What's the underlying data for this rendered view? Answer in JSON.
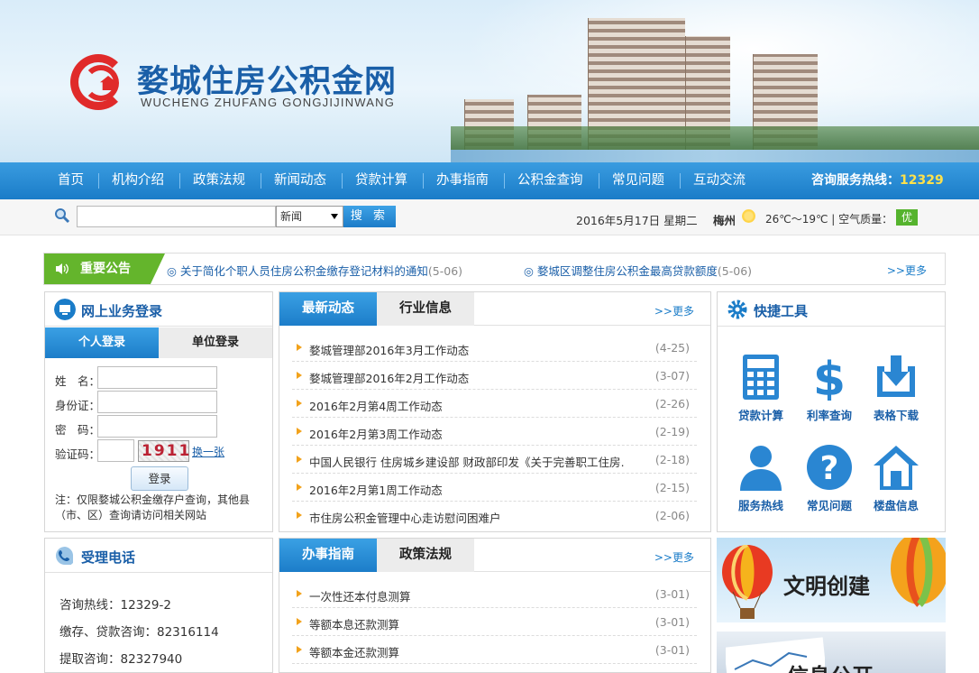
{
  "site": {
    "title": "婺城住房公积金网",
    "subtitle": "WUCHENG ZHUFANG GONGJIJINWANG"
  },
  "nav": {
    "items": [
      "首页",
      "机构介绍",
      "政策法规",
      "新闻动态",
      "贷款计算",
      "办事指南",
      "公积金查询",
      "常见问题",
      "互动交流"
    ],
    "hotline_label": "咨询服务热线：",
    "hotline_number": "12329"
  },
  "toolbar": {
    "search_value": "",
    "search_scope": "新闻",
    "search_button": "搜 索",
    "date": "2016年5月17日 星期二",
    "city": "梅州",
    "weather": "26℃～19℃ | 空气质量：",
    "air_quality": "优"
  },
  "notice": {
    "label": "重要公告",
    "items": [
      {
        "title": "关于简化个职人员住房公积金缴存登记材料的通知",
        "date": "(5-06)"
      },
      {
        "title": "婺城区调整住房公积金最高贷款额度",
        "date": "(5-06)"
      }
    ],
    "more": ">>更多"
  },
  "login": {
    "title": "网上业务登录",
    "tab_personal": "个人登录",
    "tab_unit": "单位登录",
    "name_label": "姓　名：",
    "id_label": "身份证：",
    "password_label": "密　码：",
    "captcha_label": "验证码：",
    "captcha_code": "1911",
    "captcha_refresh": "换一张",
    "submit": "登录",
    "note": "注：仅限婺城公积金缴存户查询，其他县（市、区）查询请访问相关网站"
  },
  "news": {
    "tab_active": "最新动态",
    "tab_other": "行业信息",
    "more": ">>更多",
    "items": [
      {
        "title": "婺城管理部2016年3月工作动态",
        "date": "(4-25)"
      },
      {
        "title": "婺城管理部2016年2月工作动态",
        "date": "(3-07)"
      },
      {
        "title": "2016年2月第4周工作动态",
        "date": "(2-26)"
      },
      {
        "title": "2016年2月第3周工作动态",
        "date": "(2-19)"
      },
      {
        "title": "中国人民银行 住房城乡建设部 财政部印发《关于完善职工住房…",
        "date": "(2-18)"
      },
      {
        "title": "2016年2月第1周工作动态",
        "date": "(2-15)"
      },
      {
        "title": "市住房公积金管理中心走访慰问困难户",
        "date": "(2-06)"
      }
    ]
  },
  "tools": {
    "title": "快捷工具",
    "items": [
      {
        "label": "贷款计算",
        "icon": "calculator-icon"
      },
      {
        "label": "利率查询",
        "icon": "dollar-icon"
      },
      {
        "label": "表格下载",
        "icon": "download-icon"
      },
      {
        "label": "服务热线",
        "icon": "user-icon"
      },
      {
        "label": "常见问题",
        "icon": "question-icon"
      },
      {
        "label": "楼盘信息",
        "icon": "house-icon"
      }
    ]
  },
  "phone": {
    "title": "受理电话",
    "lines": [
      "咨询热线：12329-2",
      "缴存、贷款咨询：82316114",
      "提取咨询：82327940"
    ]
  },
  "guide": {
    "tab_active": "办事指南",
    "tab_other": "政策法规",
    "more": ">>更多",
    "items": [
      {
        "title": "一次性还本付息测算",
        "date": "(3-01)"
      },
      {
        "title": "等额本息还款测算",
        "date": "(3-01)"
      },
      {
        "title": "等额本金还款测算",
        "date": "(3-01)"
      }
    ]
  },
  "promo": {
    "banner1": "文明创建",
    "banner2": "信息公开"
  },
  "colors": {
    "brand_blue": "#1a7cc8",
    "notice_green": "#64b52c",
    "accent_orange": "#f2a21b"
  }
}
